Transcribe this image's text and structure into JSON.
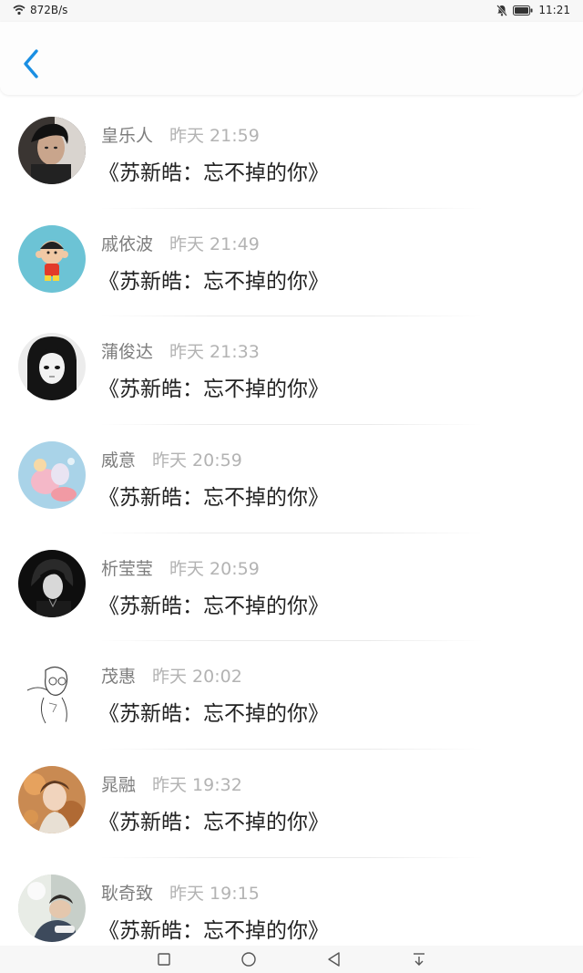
{
  "status_bar": {
    "network_speed": "872B/s",
    "time": "11:21",
    "icons": [
      "wifi-icon",
      "mute-icon",
      "battery-icon"
    ]
  },
  "header": {
    "back_icon": "chevron-left-icon",
    "accent_color": "#1a8fe3"
  },
  "comments": [
    {
      "username": "皇乐人",
      "timestamp": "昨天 21:59",
      "content": "《苏新皓：忘不掉的你》",
      "avatar": "avatar-dark-portrait"
    },
    {
      "username": "戚依波",
      "timestamp": "昨天 21:49",
      "content": "《苏新皓：忘不掉的你》",
      "avatar": "avatar-cartoon-boy"
    },
    {
      "username": "蒲俊达",
      "timestamp": "昨天 21:33",
      "content": "《苏新皓：忘不掉的你》",
      "avatar": "avatar-manga-girl"
    },
    {
      "username": "威意",
      "timestamp": "昨天 20:59",
      "content": "《苏新皓：忘不掉的你》",
      "avatar": "avatar-pastel-figure"
    },
    {
      "username": "析莹莹",
      "timestamp": "昨天 20:59",
      "content": "《苏新皓：忘不掉的你》",
      "avatar": "avatar-dark-anime"
    },
    {
      "username": "茂惠",
      "timestamp": "昨天 20:02",
      "content": "《苏新皓：忘不掉的你》",
      "avatar": "avatar-line-sketch"
    },
    {
      "username": "晁融",
      "timestamp": "昨天 19:32",
      "content": "《苏新皓：忘不掉的你》",
      "avatar": "avatar-autumn-girl"
    },
    {
      "username": "耿奇致",
      "timestamp": "昨天 19:15",
      "content": "《苏新皓：忘不掉的你》",
      "avatar": "avatar-sleeping-boy"
    }
  ],
  "nav_bar": {
    "buttons": [
      "recent-apps-icon",
      "home-icon",
      "back-triangle-icon",
      "notification-pull-icon"
    ]
  }
}
